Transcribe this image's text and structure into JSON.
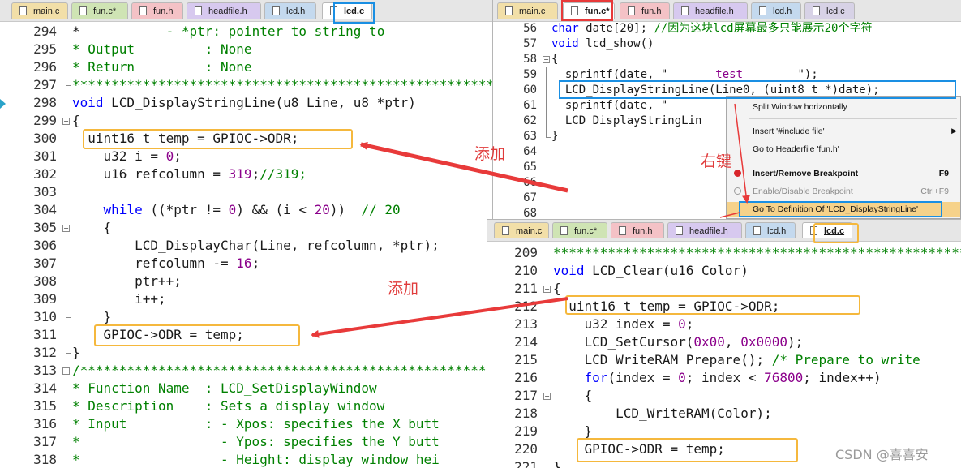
{
  "left_pane": {
    "tabs": [
      "main.c",
      "fun.c*",
      "fun.h",
      "headfile.h",
      "lcd.h",
      "lcd.c"
    ],
    "lines": [
      {
        "n": "294",
        "segs": [
          [
            "txt",
            "*"
          ],
          [
            "cmt",
            "           - *ptr: pointer to string to"
          ]
        ]
      },
      {
        "n": "295",
        "segs": [
          [
            "cmt",
            "* Output         : None"
          ]
        ]
      },
      {
        "n": "296",
        "segs": [
          [
            "cmt",
            "* Return         : None"
          ]
        ]
      },
      {
        "n": "297",
        "segs": [
          [
            "cmt",
            "***********************************************************"
          ]
        ]
      },
      {
        "n": "298",
        "segs": [
          [
            "cl",
            "void"
          ],
          [
            "txt",
            " LCD_DisplayStringLine(u8 Line, u8 *ptr)"
          ]
        ]
      },
      {
        "n": "299",
        "segs": [
          [
            "txt",
            "{"
          ]
        ]
      },
      {
        "n": "300",
        "segs": [
          [
            "txt",
            "  uint16 t temp = GPIOC->ODR;"
          ]
        ]
      },
      {
        "n": "301",
        "segs": [
          [
            "txt",
            "    u32 i = "
          ],
          [
            "num",
            "0"
          ],
          [
            "txt",
            ";"
          ]
        ]
      },
      {
        "n": "302",
        "segs": [
          [
            "txt",
            "    u16 refcolumn = "
          ],
          [
            "num",
            "319"
          ],
          [
            "txt",
            ";"
          ],
          [
            "cmt",
            "//319;"
          ]
        ]
      },
      {
        "n": "303",
        "segs": [
          [
            "txt",
            ""
          ]
        ]
      },
      {
        "n": "304",
        "segs": [
          [
            "cl",
            "    while"
          ],
          [
            "txt",
            " ((*ptr != "
          ],
          [
            "num",
            "0"
          ],
          [
            "txt",
            ") && (i < "
          ],
          [
            "num",
            "20"
          ],
          [
            "txt",
            "))  "
          ],
          [
            "cmt",
            "// 20"
          ]
        ]
      },
      {
        "n": "305",
        "segs": [
          [
            "txt",
            "    {"
          ]
        ]
      },
      {
        "n": "306",
        "segs": [
          [
            "txt",
            "        LCD_DisplayChar(Line, refcolumn, *ptr);"
          ]
        ]
      },
      {
        "n": "307",
        "segs": [
          [
            "txt",
            "        refcolumn -= "
          ],
          [
            "num",
            "16"
          ],
          [
            "txt",
            ";"
          ]
        ]
      },
      {
        "n": "308",
        "segs": [
          [
            "txt",
            "        ptr++;"
          ]
        ]
      },
      {
        "n": "309",
        "segs": [
          [
            "txt",
            "        i++;"
          ]
        ]
      },
      {
        "n": "310",
        "segs": [
          [
            "txt",
            "    }"
          ]
        ]
      },
      {
        "n": "311",
        "segs": [
          [
            "txt",
            "    GPIOC->ODR = temp;"
          ]
        ]
      },
      {
        "n": "312",
        "segs": [
          [
            "txt",
            "}"
          ]
        ]
      },
      {
        "n": "313",
        "segs": [
          [
            "cmt",
            "/**********************************************************"
          ]
        ]
      },
      {
        "n": "314",
        "segs": [
          [
            "cmt",
            "* Function Name  : LCD_SetDisplayWindow"
          ]
        ]
      },
      {
        "n": "315",
        "segs": [
          [
            "cmt",
            "* Description    : Sets a display window"
          ]
        ]
      },
      {
        "n": "316",
        "segs": [
          [
            "cmt",
            "* Input          : - Xpos: specifies the X butt"
          ]
        ]
      },
      {
        "n": "317",
        "segs": [
          [
            "cmt",
            "*                  - Ypos: specifies the Y butt"
          ]
        ]
      },
      {
        "n": "318",
        "segs": [
          [
            "cmt",
            "*                  - Height: display window hei"
          ]
        ]
      }
    ]
  },
  "top_right_pane": {
    "tabs": [
      "main.c",
      "fun.c*",
      "fun.h",
      "headfile.h",
      "lcd.h",
      "lcd.c"
    ],
    "lines": [
      {
        "n": "56",
        "segs": [
          [
            "cl",
            "char"
          ],
          [
            "txt",
            " date[20]; "
          ],
          [
            "cmt",
            "//因为这块lcd屏幕最多只能展示20个字符"
          ]
        ]
      },
      {
        "n": "57",
        "segs": [
          [
            "cl",
            "void"
          ],
          [
            "txt",
            " lcd_show()"
          ]
        ]
      },
      {
        "n": "58",
        "segs": [
          [
            "txt",
            "{"
          ]
        ]
      },
      {
        "n": "59",
        "segs": [
          [
            "txt",
            "  sprintf(date, \""
          ],
          [
            "strc",
            "       test        "
          ],
          [
            "txt",
            "\");"
          ]
        ]
      },
      {
        "n": "60",
        "segs": [
          [
            "txt",
            "  LCD_DisplayStringLine(Line0, (uint8 t *)date);"
          ]
        ]
      },
      {
        "n": "61",
        "segs": [
          [
            "txt",
            "  sprintf(date, \""
          ]
        ]
      },
      {
        "n": "62",
        "segs": [
          [
            "txt",
            "  LCD_DisplayStringLin"
          ]
        ]
      },
      {
        "n": "63",
        "segs": [
          [
            "txt",
            "}"
          ]
        ]
      },
      {
        "n": "64",
        "segs": [
          [
            "txt",
            ""
          ]
        ]
      },
      {
        "n": "65",
        "segs": [
          [
            "txt",
            ""
          ]
        ]
      },
      {
        "n": "66",
        "segs": [
          [
            "txt",
            ""
          ]
        ]
      },
      {
        "n": "67",
        "segs": [
          [
            "txt",
            ""
          ]
        ]
      },
      {
        "n": "68",
        "segs": [
          [
            "txt",
            ""
          ]
        ]
      }
    ]
  },
  "context_menu": {
    "items": [
      {
        "label": "Split Window horizontally",
        "shortcut": "",
        "bold": false,
        "disabled": false
      },
      {
        "label": "Insert '#include file'",
        "shortcut": "▶",
        "bold": false,
        "disabled": false
      },
      {
        "label": "Go to Headerfile 'fun.h'",
        "shortcut": "",
        "bold": false,
        "disabled": false
      },
      {
        "label": "Insert/Remove Breakpoint",
        "shortcut": "F9",
        "bold": true,
        "disabled": false
      },
      {
        "label": "Enable/Disable Breakpoint",
        "shortcut": "Ctrl+F9",
        "bold": false,
        "disabled": true
      },
      {
        "label": "Go To Definition Of 'LCD_DisplayStringLine'",
        "shortcut": "",
        "bold": false,
        "disabled": false
      }
    ]
  },
  "bottom_right_pane": {
    "tabs": [
      "main.c",
      "fun.c*",
      "fun.h",
      "headfile.h",
      "lcd.h",
      "lcd.c"
    ],
    "lines": [
      {
        "n": "209",
        "segs": [
          [
            "cmt",
            "*****************************************************"
          ]
        ]
      },
      {
        "n": "210",
        "segs": [
          [
            "cl",
            "void"
          ],
          [
            "txt",
            " LCD_Clear(u16 Color)"
          ]
        ]
      },
      {
        "n": "211",
        "segs": [
          [
            "txt",
            "{"
          ]
        ]
      },
      {
        "n": "212",
        "segs": [
          [
            "txt",
            "  uint16 t temp = GPIOC->ODR;"
          ]
        ]
      },
      {
        "n": "213",
        "segs": [
          [
            "txt",
            "    u32 index = "
          ],
          [
            "num",
            "0"
          ],
          [
            "txt",
            ";"
          ]
        ]
      },
      {
        "n": "214",
        "segs": [
          [
            "txt",
            "    LCD_SetCursor("
          ],
          [
            "num",
            "0x00"
          ],
          [
            "txt",
            ", "
          ],
          [
            "num",
            "0x0000"
          ],
          [
            "txt",
            ");"
          ]
        ]
      },
      {
        "n": "215",
        "segs": [
          [
            "txt",
            "    LCD_WriteRAM_Prepare(); "
          ],
          [
            "cmt",
            "/* Prepare to write"
          ]
        ]
      },
      {
        "n": "216",
        "segs": [
          [
            "cl",
            "    for"
          ],
          [
            "txt",
            "(index = "
          ],
          [
            "num",
            "0"
          ],
          [
            "txt",
            "; index < "
          ],
          [
            "num",
            "76800"
          ],
          [
            "txt",
            "; index++)"
          ]
        ]
      },
      {
        "n": "217",
        "segs": [
          [
            "txt",
            "    {"
          ]
        ]
      },
      {
        "n": "218",
        "segs": [
          [
            "txt",
            "        LCD_WriteRAM(Color);"
          ]
        ]
      },
      {
        "n": "219",
        "segs": [
          [
            "txt",
            "    }"
          ]
        ]
      },
      {
        "n": "220",
        "segs": [
          [
            "txt",
            "    GPIOC->ODR = temp;"
          ]
        ]
      },
      {
        "n": "221",
        "segs": [
          [
            "txt",
            "}"
          ]
        ]
      }
    ]
  },
  "annotations": {
    "add_1": "添加",
    "add_2": "添加",
    "right_click": "右键",
    "watermark": "CSDN @喜喜安"
  },
  "colors": {
    "highlight_box": "#f5b83d",
    "blue_box": "#1a8fe3",
    "red_box": "#e83a3a",
    "arrow": "#e83a3a",
    "keyword": "#0000ff",
    "comment": "#008000",
    "number": "#8b008b"
  }
}
